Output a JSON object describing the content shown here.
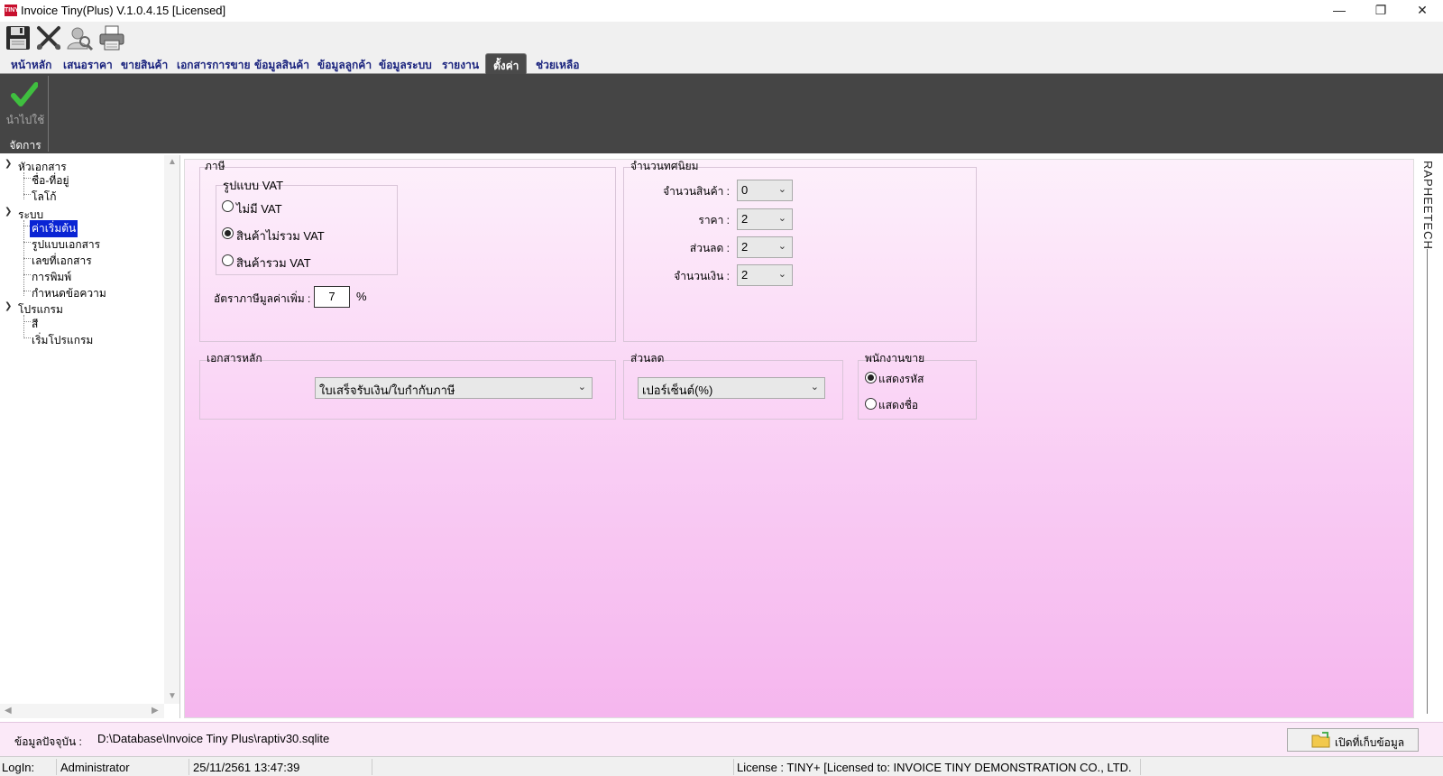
{
  "window": {
    "app_icon_text": "TINY",
    "title": "Invoice Tiny(Plus)  V.1.0.4.15 [Licensed]",
    "minimize": "—",
    "maximize": "❐",
    "close": "✕"
  },
  "toolbar": {
    "buttons": [
      "save-icon",
      "cut-icon",
      "user-search-icon",
      "print-icon"
    ]
  },
  "menu": {
    "tabs": [
      "หน้าหลัก",
      "เสนอราคา",
      "ขายสินค้า",
      "เอกสารการขาย",
      "ข้อมูลสินค้า",
      "ข้อมูลลูกค้า",
      "ข้อมูลระบบ",
      "รายงาน",
      "ตั้งค่า",
      "ช่วยเหลือ"
    ],
    "active_tab": "ตั้งค่า"
  },
  "ribbon": {
    "apply_label": "นำไปใช้",
    "group_label": "จัดการ"
  },
  "tree": {
    "nodes": [
      {
        "label": "หัวเอกสาร",
        "level": 0,
        "expanded": true
      },
      {
        "label": "ชื่อ-ที่อยู่",
        "level": 1
      },
      {
        "label": "โลโก้",
        "level": 1
      },
      {
        "label": "ระบบ",
        "level": 0,
        "expanded": true
      },
      {
        "label": "ค่าเริ่มต้น",
        "level": 1,
        "selected": true
      },
      {
        "label": "รูปแบบเอกสาร",
        "level": 1
      },
      {
        "label": "เลขที่เอกสาร",
        "level": 1
      },
      {
        "label": "การพิมพ์",
        "level": 1
      },
      {
        "label": "กำหนดข้อความ",
        "level": 1
      },
      {
        "label": "โปรแกรม",
        "level": 0,
        "expanded": true
      },
      {
        "label": "สี",
        "level": 1
      },
      {
        "label": "เริ่มโปรแกรม",
        "level": 1
      }
    ]
  },
  "tax": {
    "legend": "ภาษี",
    "vat_type_legend": "รูปแบบ VAT",
    "options": [
      "ไม่มี VAT",
      "สินค้าไม่รวม VAT",
      "สินค้ารวม VAT"
    ],
    "selected_option": "สินค้าไม่รวม VAT",
    "rate_label": "อัตราภาษีมูลค่าเพิ่ม :",
    "rate_value": "7",
    "rate_unit": "%"
  },
  "decimals": {
    "legend": "จำนวนทศนิยม",
    "rows": [
      {
        "label": "จำนวนสินค้า :",
        "value": "0"
      },
      {
        "label": "ราคา :",
        "value": "2"
      },
      {
        "label": "ส่วนลด :",
        "value": "2"
      },
      {
        "label": "จำนวนเงิน :",
        "value": "2"
      }
    ]
  },
  "main_document": {
    "legend": "เอกสารหลัก",
    "value": "ใบเสร็จรับเงิน/ใบกำกับภาษี"
  },
  "discount": {
    "legend": "ส่วนลด",
    "value": "เปอร์เซ็นต์(%)"
  },
  "salesperson": {
    "legend": "พนักงานขาย",
    "options": [
      "แสดงรหัส",
      "แสดงชื่อ"
    ],
    "selected_option": "แสดงรหัส"
  },
  "brand": "RAPHEETECH",
  "database": {
    "label": "ข้อมูลปัจจุบัน :",
    "path": "D:\\Database\\Invoice Tiny Plus\\raptiv30.sqlite",
    "open_button": "เปิดที่เก็บข้อมูล"
  },
  "status": {
    "login_label": "LogIn:",
    "user": "Administrator",
    "datetime": "25/11/2561 13:47:39",
    "license": "License : TINY+ [Licensed to: INVOICE TINY DEMONSTRATION CO., LTD."
  }
}
